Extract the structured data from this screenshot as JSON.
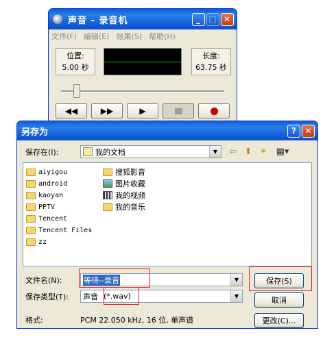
{
  "recorder": {
    "title": "声音 - 录音机",
    "menu": [
      "文件(F)",
      "编辑(E)",
      "效果(S)",
      "帮助(H)"
    ],
    "position_label": "位置:",
    "position_value": "5.00 秒",
    "length_label": "长度:",
    "length_value": "63.75 秒",
    "buttons": {
      "rewind": "◀◀",
      "forward": "▶▶",
      "play": "▶"
    },
    "minimize": "_",
    "maximize": "□",
    "close": "✕"
  },
  "dialog": {
    "title": "另存为",
    "help": "?",
    "close": "✕",
    "save_in_label": "保存在(I):",
    "save_in_value": "我的文档",
    "toolbar": {
      "back": "⇦",
      "up": "⬆",
      "new_folder": "✶",
      "view": "▦▾"
    },
    "files_col1": [
      "aiyigou",
      "android",
      "kaoyan",
      "PPTV",
      "Tencent",
      "Tencent Files",
      "zz"
    ],
    "files_col2": [
      "搜狐影音",
      "图片收藏",
      "我的视频",
      "我的音乐"
    ],
    "filename_label": "文件名(N):",
    "filename_value": "等待--录音",
    "filetype_label": "保存类型(T):",
    "filetype_value": "声音",
    "filetype_ext": "(*.wav)",
    "save_button": "保存(S)",
    "cancel_button": "取消",
    "change_button": "更改(C)...",
    "format_label": "格式:",
    "format_value": "PCM 22.050 kHz, 16 位, 单声道"
  }
}
